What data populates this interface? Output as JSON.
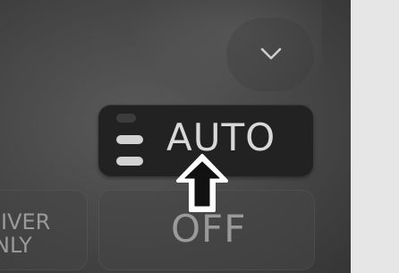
{
  "climate_panel": {
    "auto_button": {
      "label": "AUTO",
      "fan_level_bars": 3
    },
    "off_button": {
      "label": "OFF"
    },
    "driver_only_button": {
      "line1": "IVER",
      "line2": "NLY"
    },
    "expand_button": {
      "icon": "chevron-down-icon"
    },
    "press_indicator": {
      "icon": "up-arrow-icon"
    }
  },
  "colors": {
    "panel_background": "#464646",
    "button_active": "#222222",
    "label_active": "#d9d9d9",
    "label_inactive": "#9a9a9a",
    "page_background": "#e6e6e6"
  }
}
